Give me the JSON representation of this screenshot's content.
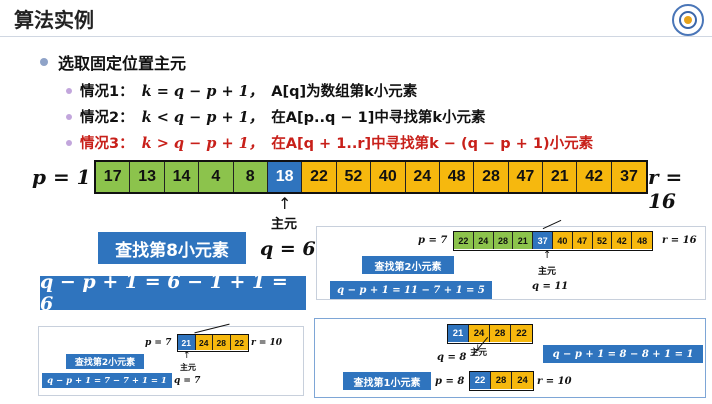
{
  "slide": {
    "title": "算法实例",
    "bullet": "选取固定位置主元",
    "cases": [
      {
        "label": "情况1：",
        "formula": "k = q − p + 1，",
        "desc": "A[q]为数组第k小元素",
        "color": "#111111"
      },
      {
        "label": "情况2：",
        "formula": "k < q − p + 1，",
        "desc": "在A[p..q − 1]中寻找第k小元素",
        "color": "#111111"
      },
      {
        "label": "情况3：",
        "formula": "k > q − p + 1，",
        "desc": "在A[q + 1..r]中寻找第k − (q − p + 1)小元素",
        "color": "#c8201a"
      }
    ]
  },
  "main": {
    "p_label": "p = 1",
    "r_label": "r = 16",
    "cells": [
      {
        "v": "17",
        "c": "g"
      },
      {
        "v": "13",
        "c": "g"
      },
      {
        "v": "14",
        "c": "g"
      },
      {
        "v": "4",
        "c": "g"
      },
      {
        "v": "8",
        "c": "g"
      },
      {
        "v": "18",
        "c": "b"
      },
      {
        "v": "22",
        "c": "y"
      },
      {
        "v": "52",
        "c": "y"
      },
      {
        "v": "40",
        "c": "y"
      },
      {
        "v": "24",
        "c": "y"
      },
      {
        "v": "48",
        "c": "y"
      },
      {
        "v": "28",
        "c": "y"
      },
      {
        "v": "47",
        "c": "y"
      },
      {
        "v": "21",
        "c": "y"
      },
      {
        "v": "42",
        "c": "y"
      },
      {
        "v": "37",
        "c": "y"
      }
    ],
    "pivot_label": "主元",
    "find_label": "查找第8小元素",
    "q_label": "q = 6",
    "equation": "q − p + 1 = 6 − 1 + 1 = 6"
  },
  "step2": {
    "p_label": "p = 7",
    "r_label": "r = 16",
    "cells": [
      {
        "v": "22",
        "c": "g"
      },
      {
        "v": "24",
        "c": "g"
      },
      {
        "v": "28",
        "c": "g"
      },
      {
        "v": "21",
        "c": "g"
      },
      {
        "v": "37",
        "c": "b"
      },
      {
        "v": "40",
        "c": "y"
      },
      {
        "v": "47",
        "c": "y"
      },
      {
        "v": "52",
        "c": "y"
      },
      {
        "v": "42",
        "c": "y"
      },
      {
        "v": "48",
        "c": "y"
      }
    ],
    "pivot_label": "主元",
    "find_label": "查找第2小元素",
    "q_label": "q = 11",
    "equation": "q − p + 1 = 11 − 7 + 1 = 5"
  },
  "step3": {
    "p_label": "p = 7",
    "r_label": "r = 10",
    "cells": [
      {
        "v": "21",
        "c": "b"
      },
      {
        "v": "24",
        "c": "y"
      },
      {
        "v": "28",
        "c": "y"
      },
      {
        "v": "22",
        "c": "y"
      }
    ],
    "pivot_label": "主元",
    "find_label": "查找第2小元素",
    "q_label": "q = 7",
    "equation": "q − p + 1 = 7 − 7 + 1 = 1"
  },
  "step4": {
    "top_cells": [
      {
        "v": "21",
        "c": "b"
      },
      {
        "v": "24",
        "c": "y"
      },
      {
        "v": "28",
        "c": "y"
      },
      {
        "v": "22",
        "c": "y"
      }
    ],
    "q_label": "q = 8",
    "pivot_label": "主元",
    "p_label": "p = 8",
    "r_label": "r = 10",
    "cells": [
      {
        "v": "22",
        "c": "b"
      },
      {
        "v": "28",
        "c": "y"
      },
      {
        "v": "24",
        "c": "y"
      }
    ],
    "find_label": "查找第1小元素",
    "equation": "q − p + 1 = 8 − 8 + 1 = 1"
  },
  "colors": {
    "green": "#8cc34c",
    "blue": "#2f74be",
    "yellow": "#f6b80e",
    "red": "#c8201a"
  }
}
